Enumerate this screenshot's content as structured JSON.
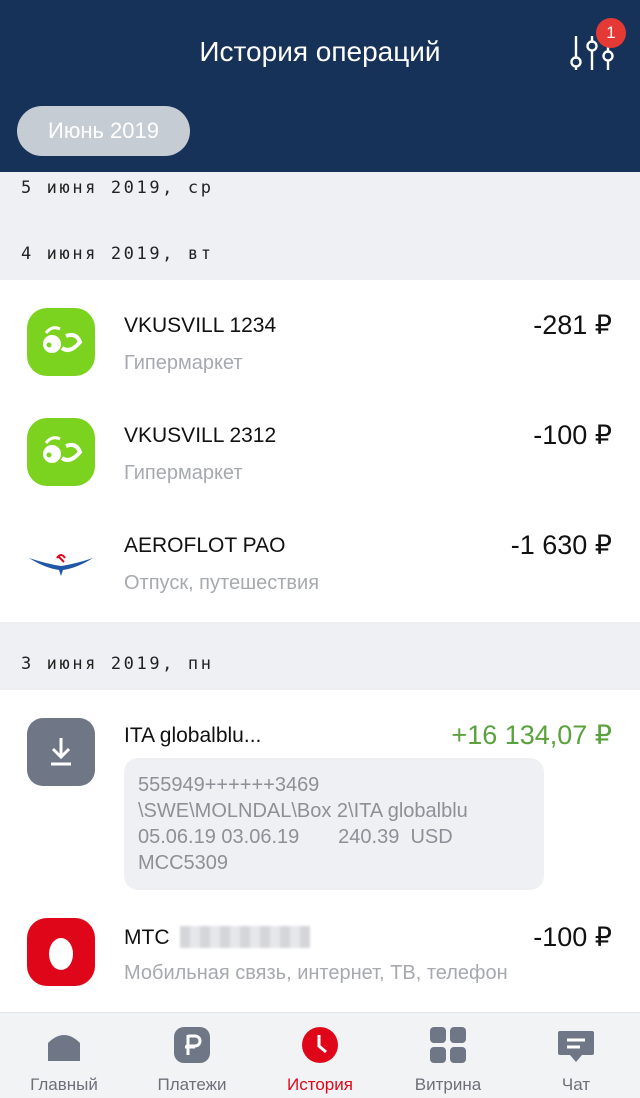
{
  "header": {
    "title": "История операций",
    "filter_badge": "1"
  },
  "month_pill": "Июнь 2019",
  "dates": [
    "5 июня 2019, ср",
    "4 июня 2019, вт",
    "3 июня 2019, пн"
  ],
  "transactions": [
    {
      "name": "VKUSVILL 1234",
      "category": "Гипермаркет",
      "amount": "-281 ₽",
      "icon": "vkusvill-logo"
    },
    {
      "name": "VKUSVILL 2312",
      "category": "Гипермаркет",
      "amount": "-100 ₽",
      "icon": "vkusvill-logo"
    },
    {
      "name": "AEROFLOT PAO",
      "category": "Отпуск, путешествия",
      "amount": "-1 630 ₽",
      "icon": "aeroflot-logo"
    },
    {
      "name": "ITA globalblu...",
      "amount": "+16 134,07 ₽",
      "icon": "download-icon",
      "memo": [
        "555949++++++3469",
        "\\SWE\\MOLNDAL\\Box 2\\ITA globalblu",
        "05.06.19 03.06.19       240.39  USD",
        "MCC5309"
      ]
    },
    {
      "name": "МТС",
      "category": "Мобильная связь, интернет, ТВ, телефон",
      "amount": "-100 ₽",
      "icon": "mts-logo"
    }
  ],
  "nav": [
    {
      "label": "Главный",
      "icon": "home-icon"
    },
    {
      "label": "Платежи",
      "icon": "ruble-icon"
    },
    {
      "label": "История",
      "icon": "clock-icon",
      "active": true
    },
    {
      "label": "Витрина",
      "icon": "grid-icon"
    },
    {
      "label": "Чат",
      "icon": "chat-icon"
    }
  ],
  "colors": {
    "header_bg": "#173259",
    "positive": "#5aa33c",
    "active_nav": "#e0061a",
    "vkusvill_green": "#7bd320",
    "mts_red": "#e0061a"
  }
}
